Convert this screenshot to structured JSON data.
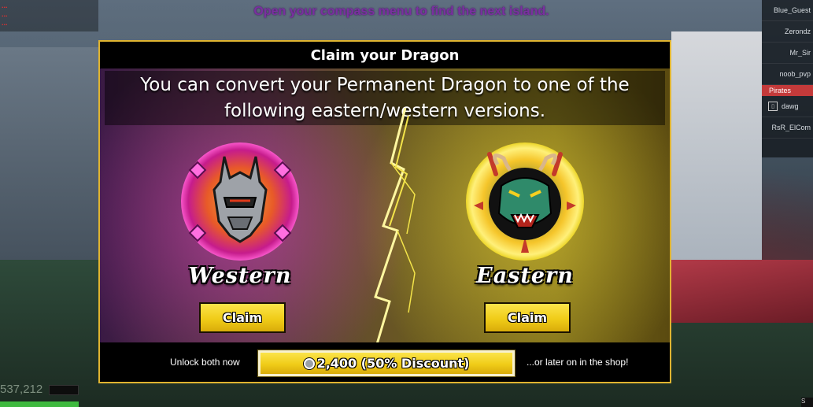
{
  "hud": {
    "quest_hint": "Open your compass menu to find the next island.",
    "notifications": [
      "...",
      "...",
      "..."
    ],
    "money": "537,212",
    "corner_text": "S"
  },
  "leaderboard": {
    "players_top": [
      "Blue_Guest",
      "Zerondz",
      "Mr_Sir",
      "noob_pvp"
    ],
    "team_label": "Pirates",
    "players_bottom": [
      "dawg",
      "RsR_ElCom"
    ]
  },
  "dialog": {
    "title": "Claim your Dragon",
    "description": "You can convert your Permanent Dragon to one of the following eastern/western versions.",
    "options": [
      {
        "label": "Western",
        "button": "Claim",
        "color": "#d63fb8",
        "icon": "western-dragon-helmet"
      },
      {
        "label": "Eastern",
        "button": "Claim",
        "color": "#f0d020",
        "icon": "eastern-dragon-head"
      }
    ],
    "unlock_left": "Unlock both now",
    "unlock_price": "2,400 (50% Discount)",
    "unlock_right": "...or later on in the shop!",
    "currency_icon": "robux-icon"
  }
}
